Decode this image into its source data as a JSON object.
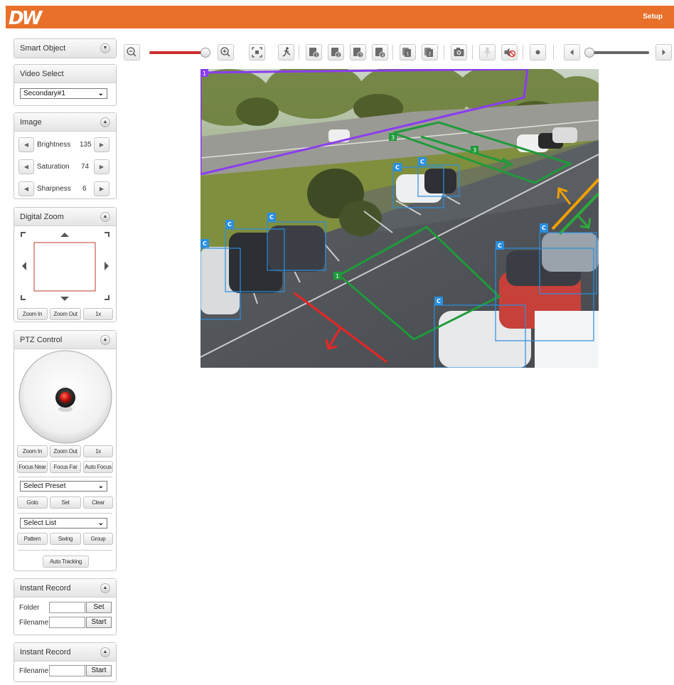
{
  "header": {
    "logo": "DW",
    "setup_label": "Setup",
    "bg_color": "#e8702a"
  },
  "smart_object": {
    "title": "Smart Object"
  },
  "video_select": {
    "title": "Video Select",
    "selected": "Secondary#1"
  },
  "image": {
    "title": "Image",
    "brightness": {
      "label": "Brightness",
      "value": "135"
    },
    "saturation": {
      "label": "Saturation",
      "value": "74"
    },
    "sharpness": {
      "label": "Sharpness",
      "value": "6"
    }
  },
  "digital_zoom": {
    "title": "Digital Zoom",
    "zoom_in": "Zoom In",
    "zoom_out": "Zoom Out",
    "one_x": "1x"
  },
  "ptz": {
    "title": "PTZ Control",
    "zoom_in": "Zoom In",
    "zoom_out": "Zoom Out",
    "one_x": "1x",
    "focus_near": "Focus Near",
    "focus_far": "Focus Far",
    "auto_focus": "Auto Focus",
    "preset_select": "Select Preset",
    "goto": "Goto",
    "set": "Set",
    "clear": "Clear",
    "list_select": "Select List",
    "pattern": "Pattern",
    "swing": "Swing",
    "group": "Group",
    "auto_tracking": "Auto Tracking"
  },
  "instant_record_1": {
    "title": "Instant Record",
    "folder_label": "Folder",
    "filename_label": "Filename",
    "set": "Set",
    "start": "Start"
  },
  "instant_record_2": {
    "title": "Instant Record",
    "filename_label": "Filename",
    "start": "Start"
  },
  "toolbar": {
    "icons": [
      "zoom-out-icon",
      "zoom-slider",
      "zoom-in-icon",
      "fit-screen-icon",
      "motion-person-icon",
      "video-1-icon",
      "video-2-icon",
      "video-3-icon",
      "video-4-icon",
      "snapshot-stack-1-icon",
      "snapshot-stack-2-icon",
      "camera-icon",
      "microphone-icon",
      "speaker-mute-icon",
      "record-icon",
      "prev-icon",
      "volume-slider",
      "next-icon"
    ],
    "zoom_slider_level": 1.0,
    "volume_slider_level": 0.0,
    "zoom_slider_color": "#cc2d2d"
  },
  "video": {
    "zone_labels": [
      "1",
      "3",
      "3",
      "1"
    ],
    "object_tag": "C",
    "zone_colors": {
      "purple": "#8a3cf0",
      "green": "#1f9a3a",
      "red": "#e82626",
      "orange": "#f0a000",
      "box": "#2a8fe0"
    }
  }
}
